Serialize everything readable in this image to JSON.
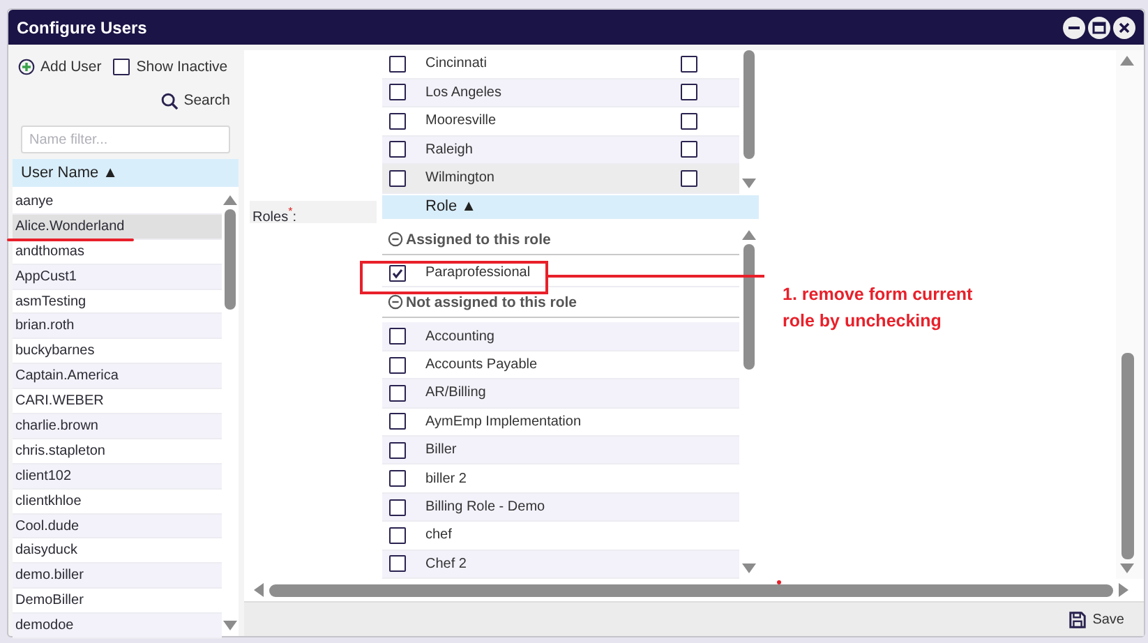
{
  "window": {
    "title": "Configure Users"
  },
  "users_panel": {
    "add_label": "Add User",
    "show_inactive": {
      "label": "Show Inactive",
      "checked": false
    },
    "search_label": "Search",
    "filter": {
      "placeholder": "Name filter..."
    },
    "column": "User Name",
    "sort_indicator": "▲",
    "users": [
      {
        "name": "aanye",
        "selected": false
      },
      {
        "name": "Alice.Wonderland",
        "selected": true
      },
      {
        "name": "andthomas",
        "selected": false
      },
      {
        "name": "AppCust1",
        "selected": false
      },
      {
        "name": "asmTesting",
        "selected": false
      },
      {
        "name": "brian.roth",
        "selected": false
      },
      {
        "name": "buckybarnes",
        "selected": false
      },
      {
        "name": "Captain.America",
        "selected": false
      },
      {
        "name": "CARI.WEBER",
        "selected": false
      },
      {
        "name": "charlie.brown",
        "selected": false
      },
      {
        "name": "chris.stapleton",
        "selected": false
      },
      {
        "name": "client102",
        "selected": false
      },
      {
        "name": "clientkhloe",
        "selected": false
      },
      {
        "name": "Cool.dude",
        "selected": false
      },
      {
        "name": "daisyduck",
        "selected": false
      },
      {
        "name": "demo.biller",
        "selected": false
      },
      {
        "name": "DemoBiller",
        "selected": false
      },
      {
        "name": "demodoe",
        "selected": false
      }
    ]
  },
  "roles_label": "Roles$^{*}$:",
  "locations": [
    {
      "name": "Cincinnati",
      "checked": false,
      "column_2_checked": false,
      "highlighted": false
    },
    {
      "name": "Los Angeles",
      "checked": false,
      "column_2_checked": false,
      "highlighted": false
    },
    {
      "name": "Mooresville",
      "checked": false,
      "column_2_checked": false,
      "highlighted": false
    },
    {
      "name": "Raleigh",
      "checked": false,
      "column_2_checked": false,
      "highlighted": false
    },
    {
      "name": "Wilmington",
      "checked": false,
      "column_2_checked": false,
      "highlighted": true
    }
  ],
  "roles": {
    "header": "Role",
    "sort_indicator": "▲",
    "groups": [
      {
        "title": "Assigned to this role",
        "expanded": true,
        "items": [
          {
            "name": "Paraprofessional",
            "checked": true
          }
        ]
      },
      {
        "title": "Not assigned to this role",
        "expanded": true,
        "items": [
          {
            "name": "Accounting",
            "checked": false
          },
          {
            "name": "Accounts Payable",
            "checked": false
          },
          {
            "name": "AR/Billing",
            "checked": false
          },
          {
            "name": "AymEmp Implementation",
            "checked": false
          },
          {
            "name": "Biller",
            "checked": false
          },
          {
            "name": "biller 2",
            "checked": false
          },
          {
            "name": "Billing Role - Demo",
            "checked": false
          },
          {
            "name": "chef",
            "checked": false
          },
          {
            "name": "Chef 2",
            "checked": false
          }
        ]
      }
    ]
  },
  "footer": {
    "save_label": "Save"
  },
  "annotation": {
    "text": "1. remove form current role by unchecking"
  }
}
